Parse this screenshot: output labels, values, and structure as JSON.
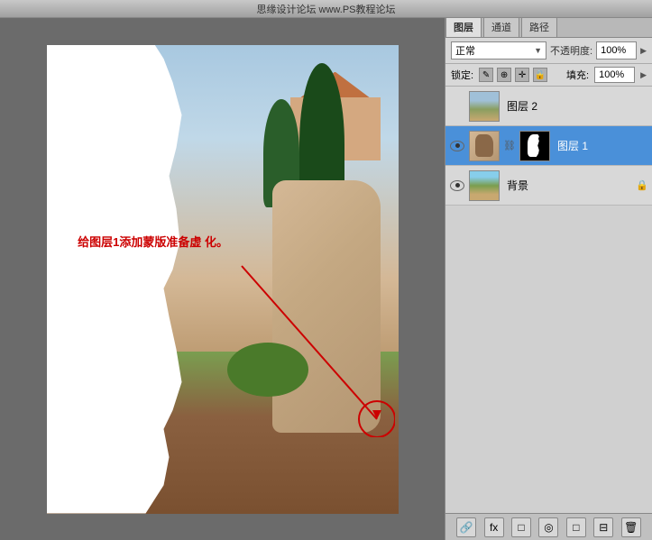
{
  "titlebar": {
    "text": "思缘设计论坛 www.PS教程论坛"
  },
  "canvas": {
    "label": "canvas-area"
  },
  "layers_panel": {
    "tabs": [
      {
        "label": "图层",
        "active": true
      },
      {
        "label": "通道"
      },
      {
        "label": "路径"
      }
    ],
    "blend_mode": {
      "value": "正常",
      "label": "不透明度:",
      "opacity_value": "100%"
    },
    "lock_row": {
      "label": "锁定:",
      "icons": [
        "✎",
        "⊕",
        "✛",
        "🔒"
      ],
      "fill_label": "填充:",
      "fill_value": "100%"
    },
    "layers": [
      {
        "name": "图层 2",
        "visible": false,
        "selected": false,
        "has_mask": false,
        "locked": false
      },
      {
        "name": "图层 1",
        "visible": true,
        "selected": true,
        "has_mask": true,
        "locked": false
      },
      {
        "name": "背景",
        "visible": true,
        "selected": false,
        "has_mask": false,
        "locked": true
      }
    ],
    "bottom_buttons": [
      "🔗",
      "fx",
      "□",
      "◎",
      "□",
      "⊟",
      "🗑"
    ]
  },
  "annotation": {
    "text": "给图层1添加蒙版准备虚\n化。",
    "color": "#cc0000"
  }
}
